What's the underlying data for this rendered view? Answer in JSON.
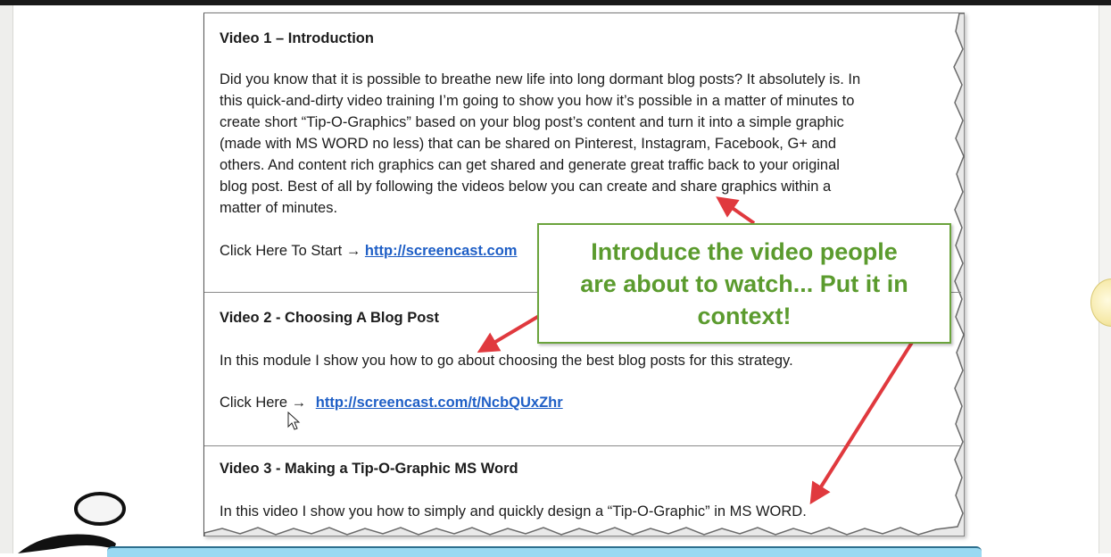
{
  "document": {
    "sections": [
      {
        "heading": "Video 1 – Introduction",
        "paragraph_lines": [
          "Did you know that it is possible to breathe new life into long dormant blog posts?  It absolutely is.  In",
          "this quick-and-dirty video training I’m going to show you how it’s possible in a matter of minutes to",
          "create short “Tip-O-Graphics” based on your blog post’s content and turn it into a simple graphic",
          "(made with MS WORD no less)  that can be shared on Pinterest, Instagram, Facebook, G+  and",
          "others.  And content rich graphics can get shared and generate great traffic back to your original",
          "blog post.  Best of all by following the videos below you can create and share graphics within a",
          "matter of minutes."
        ],
        "click_label": "Click Here  To Start →",
        "link_text": "http://screencast.com"
      },
      {
        "heading": "Video 2 - Choosing A Blog Post",
        "paragraph": "In this module I show you how to go about choosing the best blog posts for this strategy.",
        "click_label": "Click Here →",
        "link_text": "http://screencast.com/t/NcbQUxZhr"
      },
      {
        "heading": "Video 3 - Making a Tip-O-Graphic MS Word",
        "paragraph": "In this video I show you how to simply and quickly design a “Tip-O-Graphic” in MS WORD."
      }
    ]
  },
  "callout": {
    "lines": [
      "Introduce the video people",
      "are about to watch... Put it in",
      "context!"
    ],
    "text_color": "#5b9b2e",
    "border_color": "#6aa33c"
  },
  "annotation_color": "#e0393e",
  "link_color": "#1f5fc6",
  "icons": {
    "cursor": "mouse-pointer-icon",
    "logo": "brand-logo-icon",
    "edge": "yellow-circle-icon"
  }
}
